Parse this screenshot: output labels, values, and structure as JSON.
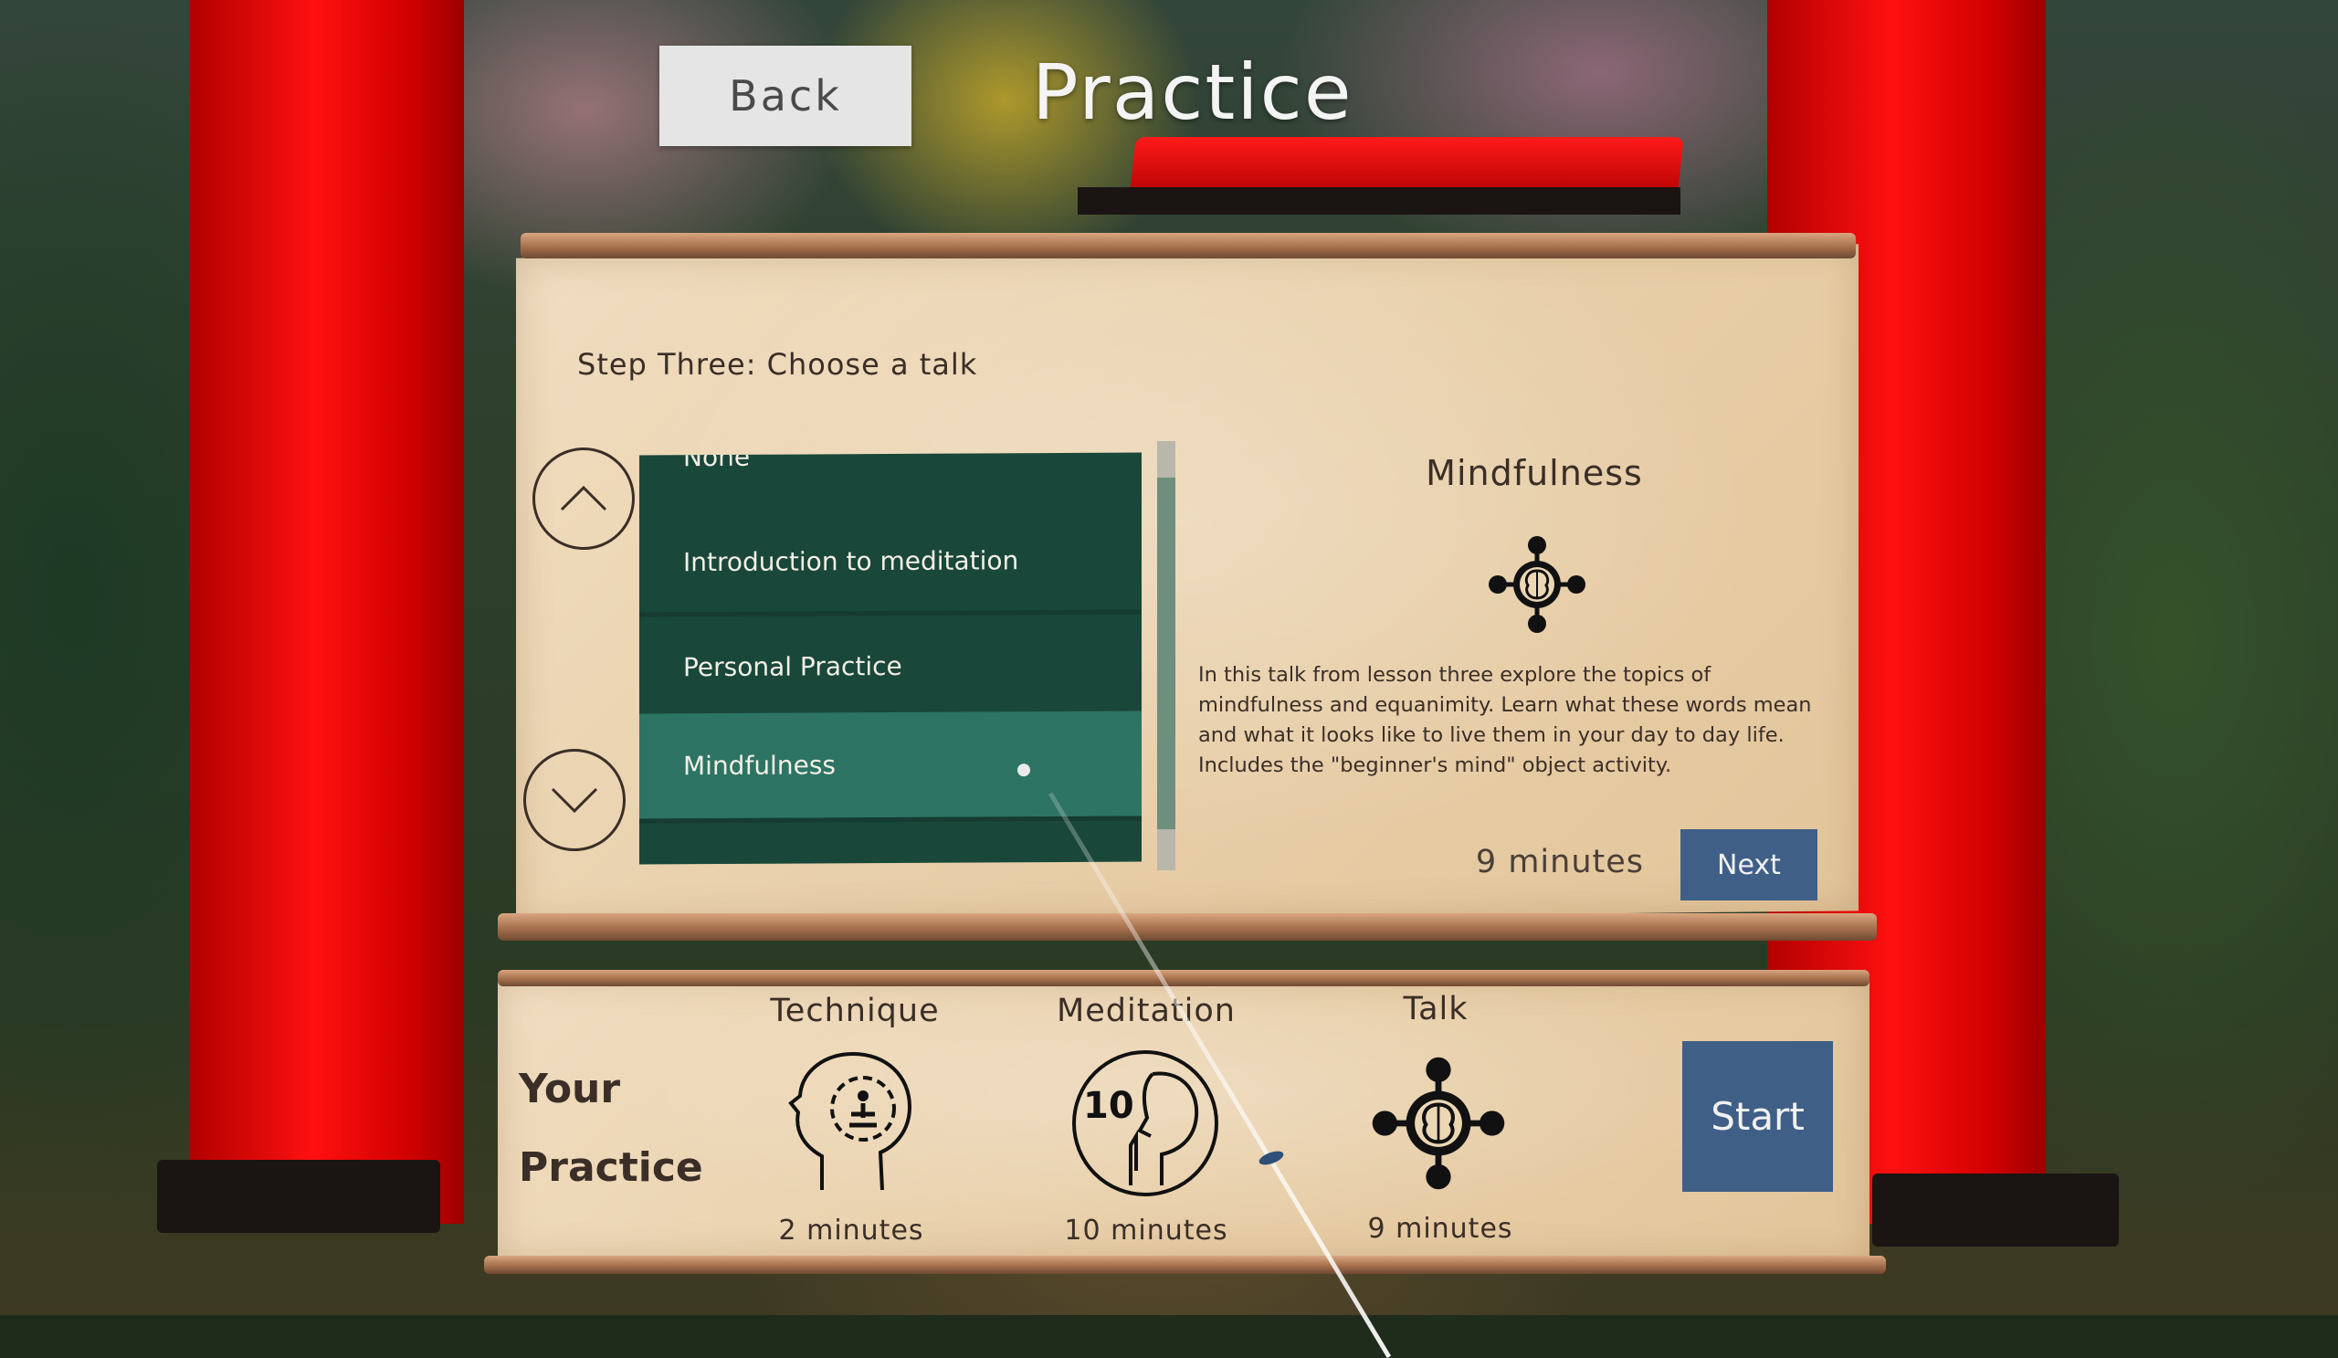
{
  "header": {
    "back_label": "Back",
    "title": "Practice"
  },
  "step": {
    "title": "Step Three: Choose a talk"
  },
  "talk_list": {
    "items": [
      {
        "label": "None",
        "partially_visible": true
      },
      {
        "label": "Introduction to meditation"
      },
      {
        "label": "Personal Practice"
      },
      {
        "label": "Mindfulness",
        "selected": true
      }
    ]
  },
  "talk_detail": {
    "title": "Mindfulness",
    "icon": "mindfulness-icon",
    "description": "In this talk from lesson three explore the topics of mindfulness and equanimity. Learn what these words mean and what it looks like to live them in your day to day life. Includes the \"beginner's mind\" object activity.",
    "duration": "9 minutes",
    "next_label": "Next"
  },
  "your_practice": {
    "heading_line1": "Your",
    "heading_line2": "Practice",
    "columns": [
      {
        "label": "Technique",
        "icon": "technique-head-icon",
        "duration": "2 minutes"
      },
      {
        "label": "Meditation",
        "icon": "meditation-10-icon",
        "duration": "10 minutes"
      },
      {
        "label": "Talk",
        "icon": "mindfulness-icon",
        "duration": "9 minutes"
      }
    ],
    "start_label": "Start"
  },
  "colors": {
    "list_bg": "#19473a",
    "list_selected": "#2d7464",
    "button_blue": "#3f5f87",
    "pillar_red": "#ff1010",
    "parchment": "#ecd7b5"
  }
}
